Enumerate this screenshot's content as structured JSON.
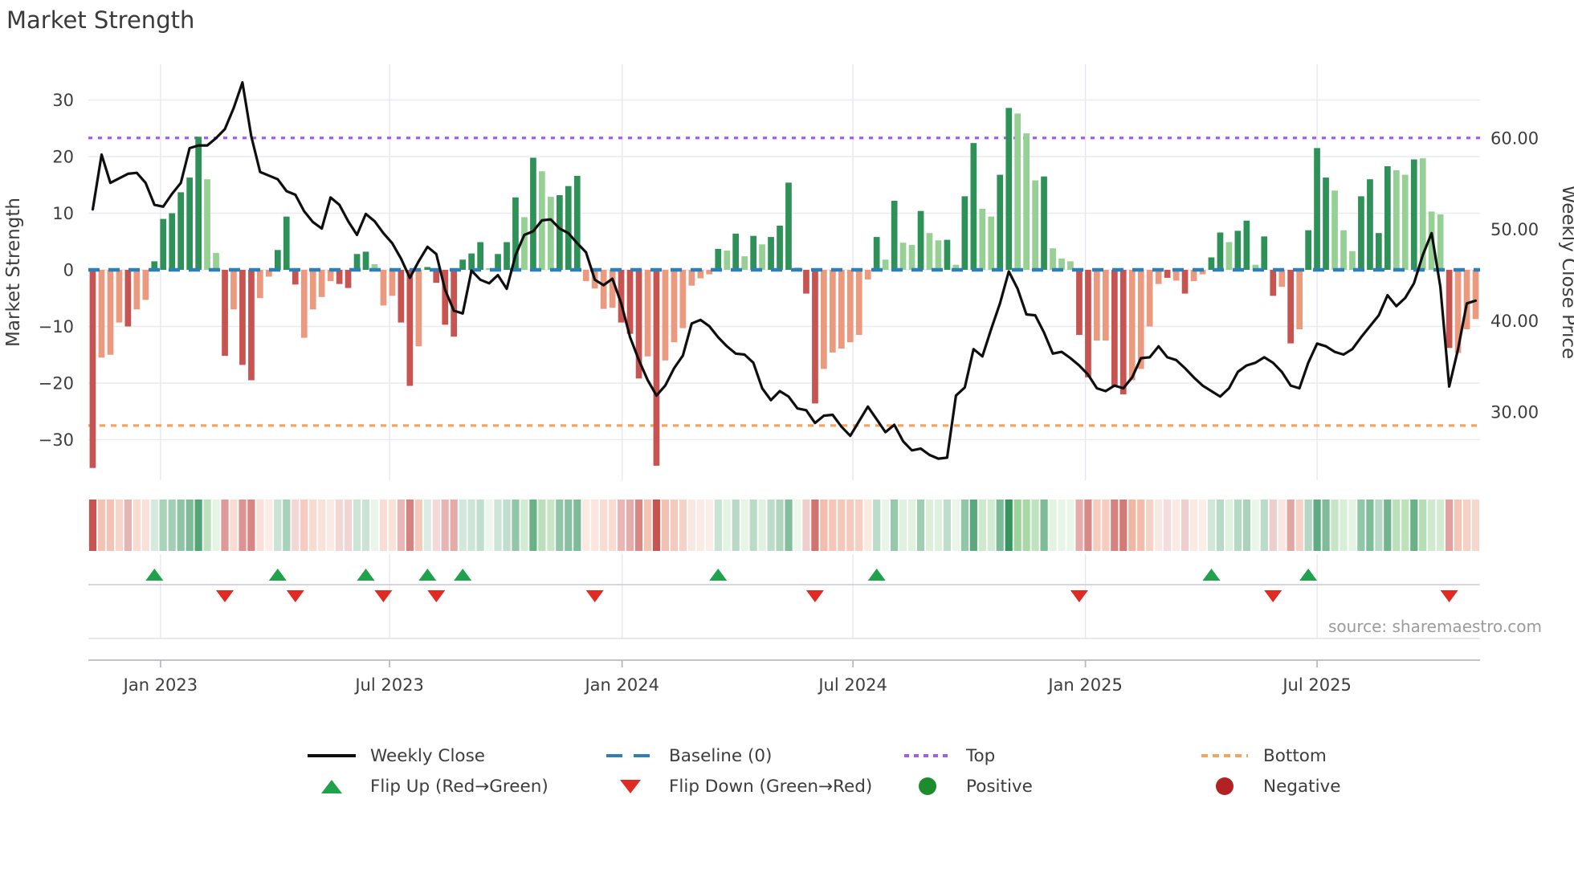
{
  "title": "Market Strength",
  "source": "source: sharemaestro.com",
  "colors": {
    "dg": "#2e9158",
    "lg": "#96d094",
    "dr": "#c75450",
    "lr": "#eb9a80",
    "line": "#0f0f0f",
    "baseline": "#2e7eb8",
    "top": "#a55ce6",
    "bottom": "#f2a55e",
    "flip_up": "#1fa24b",
    "flip_down": "#e02b25",
    "positive": "#1e8b2d",
    "negative": "#b22222"
  },
  "legend": {
    "row1": [
      {
        "label": "Weekly Close"
      },
      {
        "label": "Baseline (0)"
      },
      {
        "label": "Top"
      },
      {
        "label": "Bottom"
      }
    ],
    "row2": [
      {
        "label": "Flip Up (Red→Green)"
      },
      {
        "label": "Flip Down (Green→Red)"
      },
      {
        "label": "Positive"
      },
      {
        "label": "Negative"
      }
    ]
  },
  "chart_data": {
    "type": "bar",
    "title": "Market Strength",
    "ylabel_left": "Market Strength",
    "ylabel_right": "Weekly Close Price",
    "weeks": 158,
    "baseline": 0,
    "top_line": 23.3,
    "bottom_line": -27.5,
    "ylim_left": [
      -37.2,
      36.3
    ],
    "right_axis": {
      "ref_price": 60,
      "ref_strength": 23.26,
      "strength_per_price": 1.6128
    },
    "left_ticks": [
      {
        "label": "30",
        "value": 30
      },
      {
        "label": "20",
        "value": 20
      },
      {
        "label": "10",
        "value": 10
      },
      {
        "label": "0",
        "value": 0
      },
      {
        "label": "−10",
        "value": -10
      },
      {
        "label": "−20",
        "value": -20
      },
      {
        "label": "−30",
        "value": -30
      }
    ],
    "right_ticks": [
      {
        "label": "60.00",
        "price": 60
      },
      {
        "label": "50.00",
        "price": 50
      },
      {
        "label": "40.00",
        "price": 40
      },
      {
        "label": "30.00",
        "price": 30
      }
    ],
    "x_ticks": [
      {
        "label": "Jan 2023",
        "week": 7.7
      },
      {
        "label": "Jul 2023",
        "week": 33.7
      },
      {
        "label": "Jan 2024",
        "week": 60.1
      },
      {
        "label": "Jul 2024",
        "week": 86.3
      },
      {
        "label": "Jan 2025",
        "week": 112.7
      },
      {
        "label": "Jul 2025",
        "week": 139
      }
    ],
    "bar_values": [
      -35,
      -15.5,
      -15,
      -9.3,
      -10,
      -7,
      -5.3,
      1.5,
      9,
      10,
      13.7,
      16.3,
      23.5,
      16,
      3,
      -15.2,
      -7,
      -16.8,
      -19.5,
      -5,
      -1.2,
      3.5,
      9.4,
      -2.6,
      -12,
      -7,
      -4.8,
      -2,
      -2.5,
      -3.2,
      2.8,
      3.2,
      1.0,
      -6.3,
      -4.6,
      -9.3,
      -20.5,
      -13.5,
      0.5,
      -2.3,
      -9.7,
      -11.8,
      1.8,
      2.9,
      4.9,
      0.3,
      2.8,
      4.9,
      12.8,
      9.3,
      19.8,
      17.4,
      12.9,
      13.2,
      14.8,
      16.6,
      -2.0,
      -3.3,
      -6.9,
      -6.7,
      -9.3,
      -11.3,
      -19.2,
      -15.3,
      -34.6,
      -16.0,
      -12.8,
      -10.3,
      -2.8,
      -1.5,
      -0.8,
      3.7,
      3.4,
      6.4,
      2.4,
      6.0,
      4.5,
      5.8,
      7.8,
      15.4,
      0.4,
      -4.2,
      -23.6,
      -17.5,
      -14.6,
      -13.9,
      -12.8,
      -11.5,
      -1.7,
      5.8,
      1.8,
      12.2,
      4.8,
      4.4,
      10.4,
      6.5,
      5.2,
      5.3,
      0.9,
      13.0,
      22.4,
      10.8,
      9.4,
      16.8,
      28.6,
      27.6,
      24.1,
      15.8,
      16.5,
      3.8,
      2.0,
      1.5,
      -11.5,
      -19.0,
      -12.5,
      -12.5,
      -20.5,
      -22.0,
      -19.5,
      -17.5,
      -10.0,
      -2.5,
      -1.4,
      -1.9,
      -4.2,
      -2.0,
      -0.8,
      2.2,
      6.6,
      4.9,
      6.9,
      8.7,
      0.9,
      5.9,
      -4.6,
      -3.0,
      -13.0,
      -10.5,
      7.0,
      21.5,
      16.3,
      14.0,
      7.0,
      3.3,
      13.0,
      16.0,
      6.5,
      18.3,
      17.6,
      16.8,
      19.5,
      19.7,
      10.3,
      9.8,
      -13.8,
      -14.7,
      -10.5,
      -8.7
    ],
    "bar_colors": [
      "dr",
      "lr",
      "lr",
      "lr",
      "dr",
      "lr",
      "lr",
      "dg",
      "dg",
      "dg",
      "dg",
      "dg",
      "dg",
      "lg",
      "lg",
      "dr",
      "lr",
      "dr",
      "dr",
      "lr",
      "lr",
      "dg",
      "dg",
      "dr",
      "lr",
      "lr",
      "lr",
      "lr",
      "dr",
      "dr",
      "dg",
      "dg",
      "lg",
      "lr",
      "lr",
      "dr",
      "dr",
      "lr",
      "dg",
      "dr",
      "dr",
      "dr",
      "dg",
      "dg",
      "dg",
      "lg",
      "dg",
      "dg",
      "dg",
      "lg",
      "dg",
      "lg",
      "lg",
      "dg",
      "dg",
      "dg",
      "lr",
      "lr",
      "lr",
      "lr",
      "dr",
      "dr",
      "dr",
      "lr",
      "dr",
      "lr",
      "lr",
      "lr",
      "lr",
      "lr",
      "lr",
      "dg",
      "lg",
      "dg",
      "lg",
      "dg",
      "lg",
      "dg",
      "dg",
      "dg",
      "lg",
      "dr",
      "dr",
      "lr",
      "lr",
      "lr",
      "lr",
      "lr",
      "lr",
      "dg",
      "lg",
      "dg",
      "lg",
      "lg",
      "dg",
      "lg",
      "lg",
      "dg",
      "lg",
      "dg",
      "dg",
      "lg",
      "lg",
      "dg",
      "dg",
      "lg",
      "lg",
      "lg",
      "dg",
      "lg",
      "lg",
      "lg",
      "dr",
      "dr",
      "lr",
      "lr",
      "dr",
      "dr",
      "lr",
      "lr",
      "lr",
      "lr",
      "dr",
      "lr",
      "dr",
      "lr",
      "lr",
      "dg",
      "dg",
      "lg",
      "dg",
      "dg",
      "lg",
      "dg",
      "dr",
      "lr",
      "dr",
      "lr",
      "dg",
      "dg",
      "dg",
      "lg",
      "lg",
      "lg",
      "dg",
      "dg",
      "dg",
      "dg",
      "lg",
      "lg",
      "dg",
      "lg",
      "lg",
      "lg",
      "dr",
      "lr",
      "lr",
      "lr"
    ],
    "line_prices": [
      52.2,
      58.2,
      55.1,
      55.6,
      56.1,
      56.2,
      55.1,
      52.7,
      52.5,
      53.9,
      55.1,
      58.9,
      59.2,
      59.2,
      60.0,
      61.0,
      63.3,
      66.1,
      60.2,
      56.3,
      55.9,
      55.5,
      54.2,
      53.8,
      52.0,
      50.8,
      50.1,
      53.5,
      52.7,
      50.9,
      49.4,
      51.7,
      50.9,
      49.6,
      48.5,
      46.8,
      44.7,
      46.5,
      48.1,
      47.3,
      43.4,
      41.1,
      40.8,
      45.5,
      44.5,
      44.1,
      45.0,
      43.5,
      47.2,
      49.4,
      49.8,
      51.0,
      51.1,
      50.1,
      49.6,
      48.5,
      47.5,
      44.5,
      43.9,
      44.6,
      41.9,
      38.2,
      35.7,
      33.5,
      31.8,
      32.9,
      34.8,
      36.2,
      39.7,
      40.1,
      39.4,
      38.2,
      37.2,
      36.4,
      36.3,
      35.4,
      32.6,
      31.3,
      32.3,
      31.7,
      30.4,
      30.2,
      28.8,
      29.6,
      29.7,
      28.4,
      27.4,
      29.0,
      30.6,
      29.2,
      27.8,
      28.6,
      26.8,
      25.8,
      26.0,
      25.3,
      24.9,
      25.0,
      31.8,
      32.7,
      36.9,
      36.1,
      39.1,
      41.9,
      45.4,
      43.5,
      40.7,
      40.6,
      38.7,
      36.4,
      36.6,
      35.9,
      35.1,
      34.1,
      32.6,
      32.3,
      32.9,
      32.6,
      33.8,
      35.9,
      36.0,
      37.2,
      36.0,
      35.7,
      34.8,
      33.8,
      32.9,
      32.3,
      31.7,
      32.6,
      34.4,
      35.1,
      35.4,
      36.0,
      35.4,
      34.4,
      32.9,
      32.6,
      35.4,
      37.5,
      37.2,
      36.6,
      36.3,
      36.9,
      38.2,
      39.4,
      40.6,
      42.8,
      41.6,
      42.5,
      44.1,
      47.2,
      49.6,
      43.7,
      32.8,
      36.9,
      41.9,
      42.2
    ],
    "flip_up_weeks": [
      7,
      21,
      31,
      38,
      42,
      71,
      89,
      127,
      138
    ],
    "flip_down_weeks": [
      15,
      23,
      33,
      39,
      57,
      82,
      112,
      134,
      154
    ]
  }
}
